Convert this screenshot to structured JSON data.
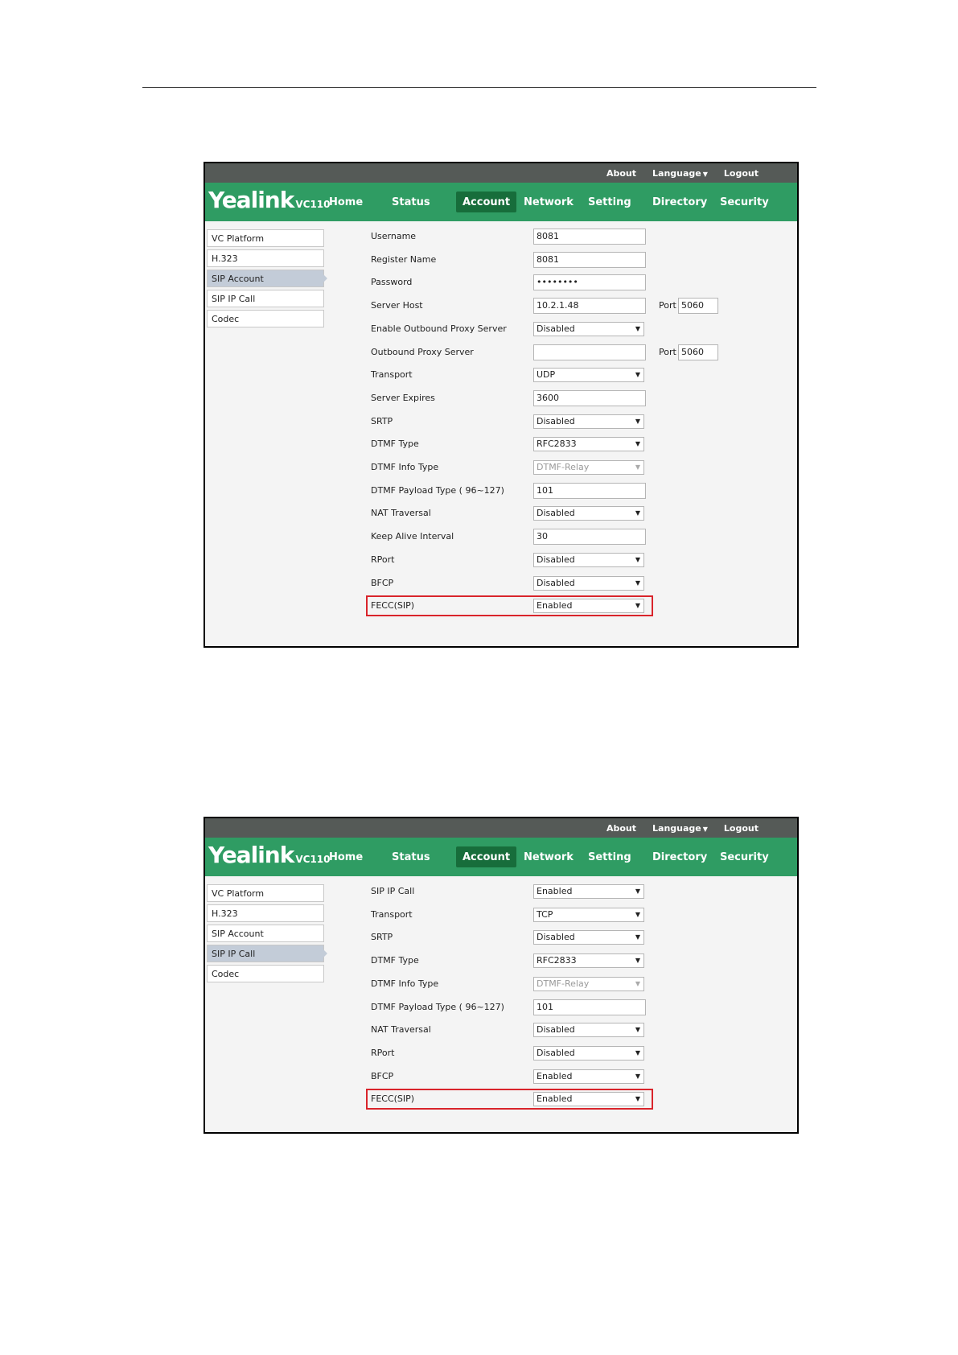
{
  "screenshots": [
    {
      "top_links": {
        "about": "About",
        "language": "Language",
        "logout": "Logout"
      },
      "brand": {
        "logo": "Yealink",
        "model": "VC110"
      },
      "nav": [
        "Home",
        "Status",
        "Account",
        "Network",
        "Setting",
        "Directory",
        "Security"
      ],
      "active_nav": "Account",
      "sidebar": [
        "VC Platform",
        "H.323",
        "SIP Account",
        "SIP IP Call",
        "Codec"
      ],
      "active_sidebar": "SIP Account",
      "fields": [
        {
          "label": "Username",
          "type": "text",
          "value": "8081"
        },
        {
          "label": "Register Name",
          "type": "text",
          "value": "8081"
        },
        {
          "label": "Password",
          "type": "text",
          "value": "••••••••"
        },
        {
          "label": "Server Host",
          "type": "text",
          "value": "10.2.1.48",
          "port_label": "Port",
          "port": "5060"
        },
        {
          "label": "Enable Outbound Proxy Server",
          "type": "select",
          "value": "Disabled"
        },
        {
          "label": "Outbound Proxy Server",
          "type": "text",
          "value": "",
          "port_label": "Port",
          "port": "5060"
        },
        {
          "label": "Transport",
          "type": "select",
          "value": "UDP"
        },
        {
          "label": "Server Expires",
          "type": "text",
          "value": "3600"
        },
        {
          "label": "SRTP",
          "type": "select",
          "value": "Disabled"
        },
        {
          "label": "DTMF Type",
          "type": "select",
          "value": "RFC2833"
        },
        {
          "label": "DTMF Info Type",
          "type": "select",
          "value": "DTMF-Relay",
          "disabled": true
        },
        {
          "label": "DTMF Payload Type ( 96~127)",
          "type": "text",
          "value": "101"
        },
        {
          "label": "NAT Traversal",
          "type": "select",
          "value": "Disabled"
        },
        {
          "label": "Keep Alive Interval",
          "type": "text",
          "value": "30"
        },
        {
          "label": "RPort",
          "type": "select",
          "value": "Disabled"
        },
        {
          "label": "BFCP",
          "type": "select",
          "value": "Disabled"
        },
        {
          "label": "FECC(SIP)",
          "type": "select",
          "value": "Enabled",
          "highlight": true
        }
      ]
    },
    {
      "top_links": {
        "about": "About",
        "language": "Language",
        "logout": "Logout"
      },
      "brand": {
        "logo": "Yealink",
        "model": "VC110"
      },
      "nav": [
        "Home",
        "Status",
        "Account",
        "Network",
        "Setting",
        "Directory",
        "Security"
      ],
      "active_nav": "Account",
      "sidebar": [
        "VC Platform",
        "H.323",
        "SIP Account",
        "SIP IP Call",
        "Codec"
      ],
      "active_sidebar": "SIP IP Call",
      "fields": [
        {
          "label": "SIP IP Call",
          "type": "select",
          "value": "Enabled"
        },
        {
          "label": "Transport",
          "type": "select",
          "value": "TCP"
        },
        {
          "label": "SRTP",
          "type": "select",
          "value": "Disabled"
        },
        {
          "label": "DTMF Type",
          "type": "select",
          "value": "RFC2833"
        },
        {
          "label": "DTMF Info Type",
          "type": "select",
          "value": "DTMF-Relay",
          "disabled": true
        },
        {
          "label": "DTMF Payload Type ( 96~127)",
          "type": "text",
          "value": "101"
        },
        {
          "label": "NAT Traversal",
          "type": "select",
          "value": "Disabled"
        },
        {
          "label": "RPort",
          "type": "select",
          "value": "Disabled"
        },
        {
          "label": "BFCP",
          "type": "select",
          "value": "Enabled"
        },
        {
          "label": "FECC(SIP)",
          "type": "select",
          "value": "Enabled",
          "highlight": true
        }
      ]
    }
  ],
  "colors": {
    "nav_green": "#2f9c63",
    "active_tab": "#176d3b",
    "top_bar": "#555a57",
    "highlight": "#d9242b"
  }
}
